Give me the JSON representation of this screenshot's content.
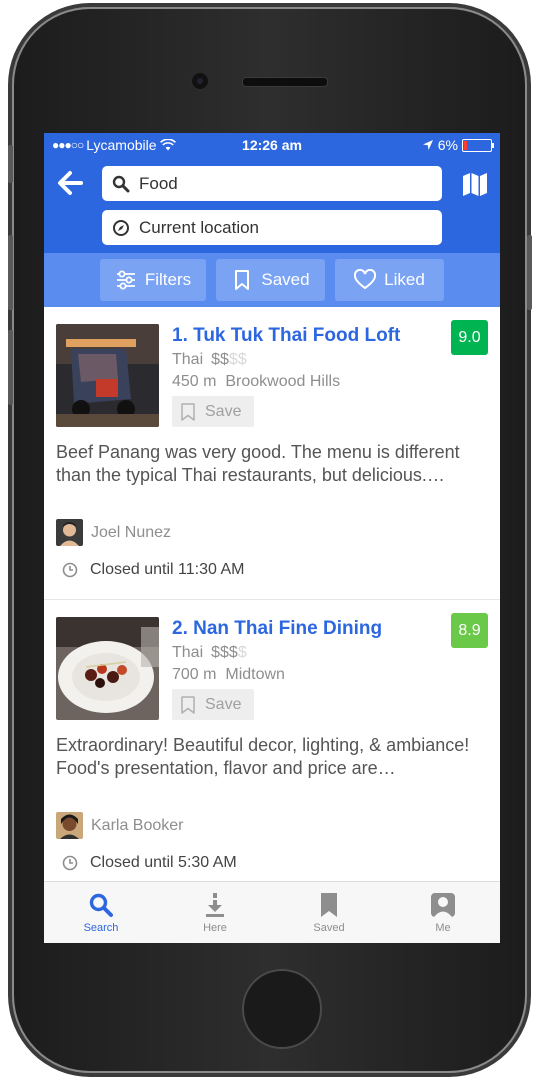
{
  "status": {
    "carrier": "Lycamobile",
    "signal_dots": "●●●○○",
    "time": "12:26 am",
    "battery": "6%",
    "battery_level": 0.06
  },
  "search": {
    "query": "Food",
    "location": "Current location"
  },
  "filters": {
    "filters_label": "Filters",
    "saved_label": "Saved",
    "liked_label": "Liked"
  },
  "venues": [
    {
      "title": "1. Tuk Tuk Thai Food Loft",
      "score": "9.0",
      "score_color": "#00b551",
      "category": "Thai",
      "price": "$$",
      "price_dim": "$$",
      "distance": "450 m",
      "neighborhood": "Brookwood Hills",
      "save_label": "Save",
      "review": "Beef Panang was very good. The menu is different than the typical Thai restaurants, but delicious.…",
      "user": "Joel Nunez",
      "hours": "Closed until 11:30 AM"
    },
    {
      "title": "2. Nan Thai Fine Dining",
      "score": "8.9",
      "score_color": "#6bc94a",
      "category": "Thai",
      "price": "$$$",
      "price_dim": "$",
      "distance": "700 m",
      "neighborhood": "Midtown",
      "save_label": "Save",
      "review": "Extraordinary! Beautiful decor, lighting, & ambiance! Food's presentation, flavor and price are…",
      "user": "Karla Booker",
      "hours": "Closed until 5:30 AM"
    }
  ],
  "tabs": [
    {
      "label": "Search",
      "icon": "search-icon",
      "active": true
    },
    {
      "label": "Here",
      "icon": "download-arrow-icon",
      "active": false
    },
    {
      "label": "Saved",
      "icon": "bookmark-icon",
      "active": false
    },
    {
      "label": "Me",
      "icon": "profile-icon",
      "active": false
    }
  ],
  "colors": {
    "accent": "#2d67e0",
    "filter_bar": "#5a8cf0"
  }
}
